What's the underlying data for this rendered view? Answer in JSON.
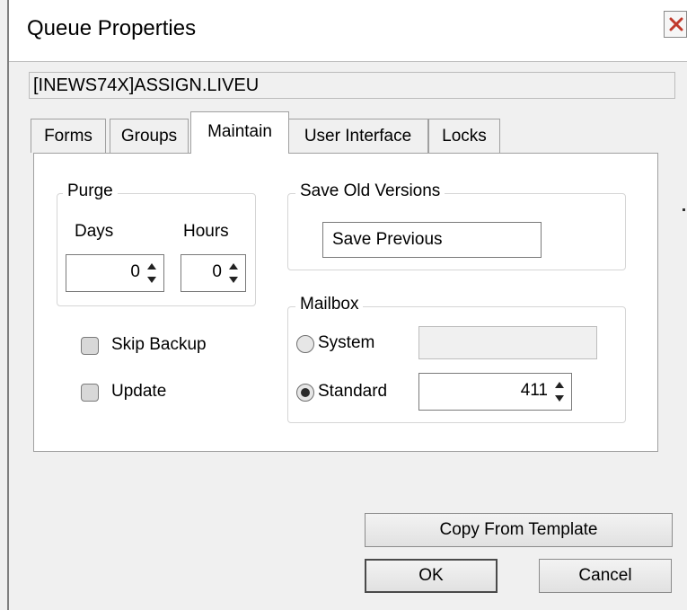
{
  "window": {
    "title": "Queue Properties",
    "close_icon": "close-icon"
  },
  "queue_path": "[INEWS74X]ASSIGN.LIVEU",
  "tabs": [
    {
      "label": "Forms",
      "active": false
    },
    {
      "label": "Groups",
      "active": false
    },
    {
      "label": "Maintain",
      "active": true
    },
    {
      "label": "User Interface",
      "active": false
    },
    {
      "label": "Locks",
      "active": false
    }
  ],
  "purge": {
    "legend": "Purge",
    "days_label": "Days",
    "days_value": "0",
    "hours_label": "Hours",
    "hours_value": "0"
  },
  "options": {
    "skip_backup_label": "Skip Backup",
    "skip_backup_checked": false,
    "update_label": "Update",
    "update_checked": false
  },
  "save_old_versions": {
    "legend": "Save Old Versions",
    "value": "Save Previous"
  },
  "mailbox": {
    "legend": "Mailbox",
    "system_label": "System",
    "system_selected": false,
    "system_value": "",
    "standard_label": "Standard",
    "standard_selected": true,
    "standard_value": "411"
  },
  "buttons": {
    "copy_template": "Copy From Template",
    "ok": "OK",
    "cancel": "Cancel"
  }
}
